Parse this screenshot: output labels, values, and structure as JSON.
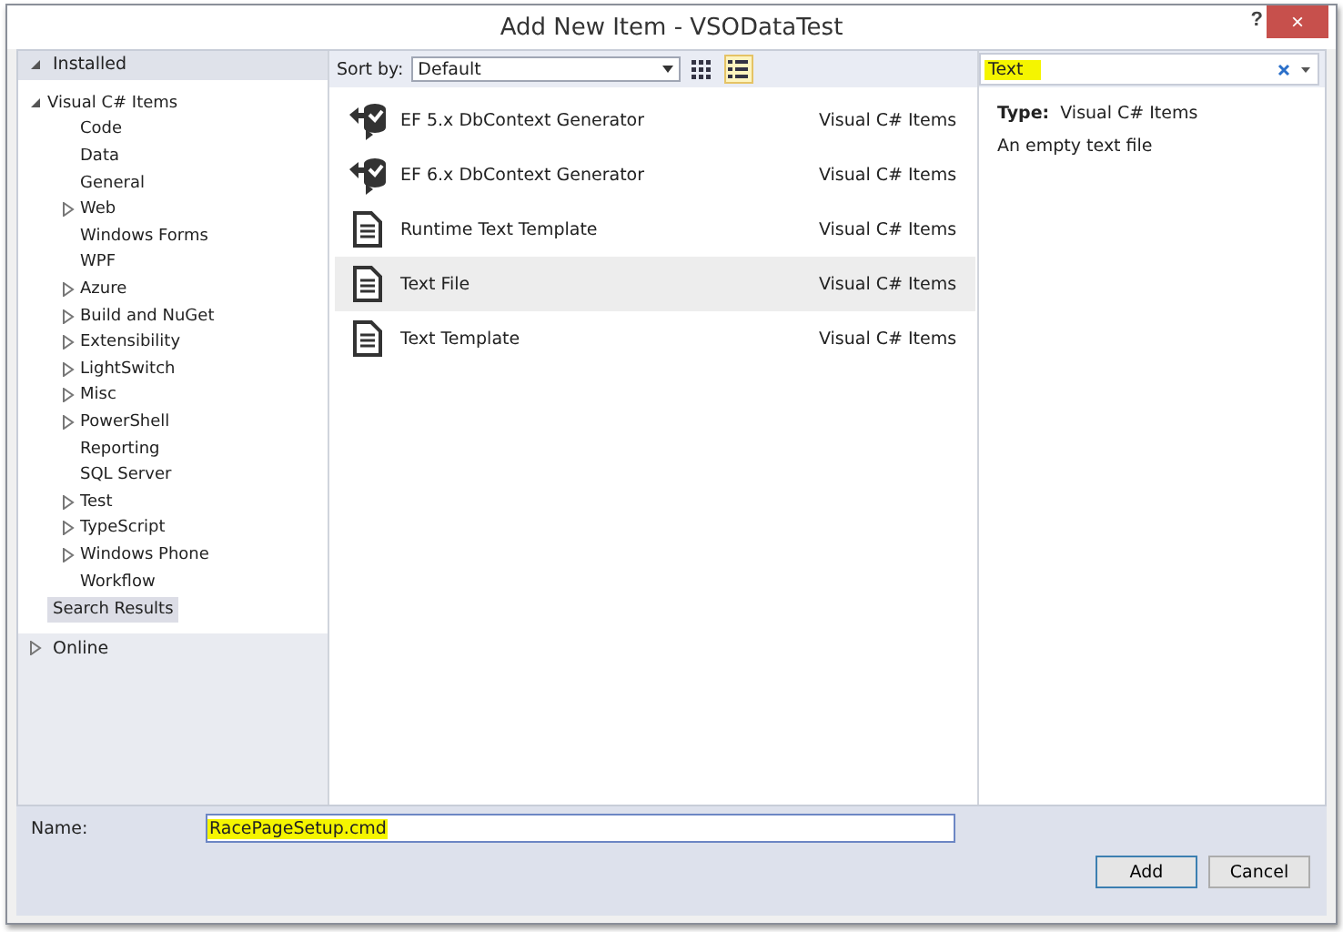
{
  "window": {
    "title": "Add New Item - VSODataTest",
    "help": "?",
    "close": "×"
  },
  "sidebar": {
    "sections": [
      {
        "label": "Installed",
        "expanded": true,
        "tree": [
          {
            "label": "Visual C# Items",
            "expanded": true,
            "selected": false,
            "children": [
              {
                "label": "Code",
                "expandable": false,
                "selected": false
              },
              {
                "label": "Data",
                "expandable": false,
                "selected": false
              },
              {
                "label": "General",
                "expandable": false,
                "selected": false
              },
              {
                "label": "Web",
                "expandable": true,
                "selected": false
              },
              {
                "label": "Windows Forms",
                "expandable": false,
                "selected": false
              },
              {
                "label": "WPF",
                "expandable": false,
                "selected": false
              },
              {
                "label": "Azure",
                "expandable": true,
                "selected": false
              },
              {
                "label": "Build and NuGet",
                "expandable": true,
                "selected": false
              },
              {
                "label": "Extensibility",
                "expandable": true,
                "selected": false
              },
              {
                "label": "LightSwitch",
                "expandable": true,
                "selected": false
              },
              {
                "label": "Misc",
                "expandable": true,
                "selected": false
              },
              {
                "label": "PowerShell",
                "expandable": true,
                "selected": false
              },
              {
                "label": "Reporting",
                "expandable": false,
                "selected": false
              },
              {
                "label": "SQL Server",
                "expandable": false,
                "selected": false
              },
              {
                "label": "Test",
                "expandable": true,
                "selected": false
              },
              {
                "label": "TypeScript",
                "expandable": true,
                "selected": false
              },
              {
                "label": "Windows Phone",
                "expandable": true,
                "selected": false
              },
              {
                "label": "Workflow",
                "expandable": false,
                "selected": false
              }
            ]
          },
          {
            "label": "Search Results",
            "selected": true
          }
        ]
      },
      {
        "label": "Online",
        "expanded": false
      }
    ]
  },
  "toolbar": {
    "sort_label": "Sort by:",
    "sort_value": "Default",
    "views": [
      {
        "kind": "grid",
        "selected": false
      },
      {
        "kind": "list",
        "selected": true
      }
    ]
  },
  "search": {
    "value": "Text",
    "highlighted": true
  },
  "items": [
    {
      "name": "EF 5.x DbContext Generator",
      "category": "Visual C# Items",
      "kind": "generator",
      "selected": false
    },
    {
      "name": "EF 6.x DbContext Generator",
      "category": "Visual C# Items",
      "kind": "generator",
      "selected": false
    },
    {
      "name": "Runtime Text Template",
      "category": "Visual C# Items",
      "kind": "document",
      "selected": false
    },
    {
      "name": "Text File",
      "category": "Visual C# Items",
      "kind": "document",
      "selected": true
    },
    {
      "name": "Text Template",
      "category": "Visual C# Items",
      "kind": "document",
      "selected": false
    }
  ],
  "details": {
    "type_label": "Type:",
    "type_value": "Visual C# Items",
    "description": "An empty text file"
  },
  "name_field": {
    "label": "Name:",
    "value": "RacePageSetup.cmd",
    "highlighted": true
  },
  "buttons": [
    {
      "label": "Add",
      "default": true
    },
    {
      "label": "Cancel",
      "default": false
    }
  ]
}
